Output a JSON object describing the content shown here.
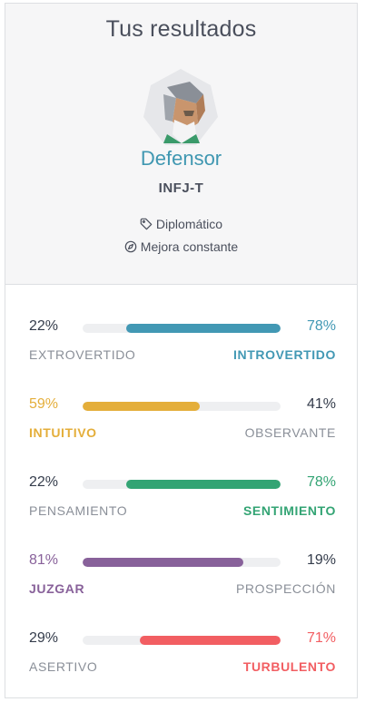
{
  "header": {
    "title": "Tus resultados",
    "type_name": "Defensor",
    "type_code": "INFJ-T",
    "role": {
      "icon": "tag-icon",
      "label": "Diplomático"
    },
    "strategy": {
      "icon": "compass-icon",
      "label": "Mejora constante"
    }
  },
  "colors": {
    "blue": "#4298b4",
    "yellow": "#e4ae3a",
    "green": "#33a474",
    "purple": "#88619a",
    "red": "#f25e62"
  },
  "traits": [
    {
      "left_pct": "22%",
      "right_pct": "78%",
      "left_label": "EXTROVERTIDO",
      "right_label": "INTROVERTIDO",
      "dominant": "right",
      "fill_percent": 78,
      "color": "#4298b4"
    },
    {
      "left_pct": "59%",
      "right_pct": "41%",
      "left_label": "INTUITIVO",
      "right_label": "OBSERVANTE",
      "dominant": "left",
      "fill_percent": 59,
      "color": "#e4ae3a"
    },
    {
      "left_pct": "22%",
      "right_pct": "78%",
      "left_label": "PENSAMIENTO",
      "right_label": "SENTIMIENTO",
      "dominant": "right",
      "fill_percent": 78,
      "color": "#33a474"
    },
    {
      "left_pct": "81%",
      "right_pct": "19%",
      "left_label": "JUZGAR",
      "right_label": "PROSPECCIÓN",
      "dominant": "left",
      "fill_percent": 81,
      "color": "#88619a"
    },
    {
      "left_pct": "29%",
      "right_pct": "71%",
      "left_label": "ASERTIVO",
      "right_label": "TURBULENTO",
      "dominant": "right",
      "fill_percent": 71,
      "color": "#f25e62"
    }
  ]
}
